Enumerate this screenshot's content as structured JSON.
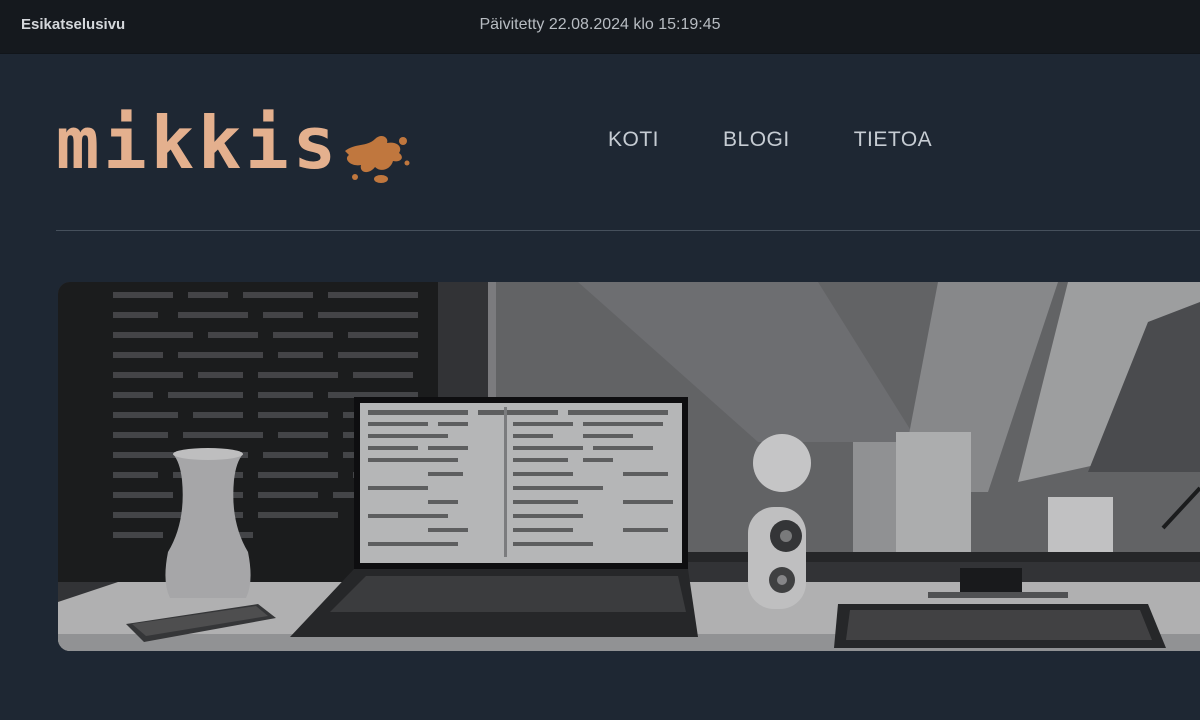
{
  "topbar": {
    "preview_label": "Esikatselusivu",
    "updated_text": "Päivitetty 22.08.2024 klo 15:19:45"
  },
  "brand": {
    "logo_text": "mikkis",
    "logo_color": "#e4b08e",
    "splat_color": "#c0773e"
  },
  "nav": {
    "items": [
      {
        "label": "KOTI"
      },
      {
        "label": "BLOGI"
      },
      {
        "label": "TIETOA"
      }
    ]
  },
  "hero": {
    "description": "grayscale illustration of a desk workspace with laptop, vase, speaker and monitor"
  },
  "colors": {
    "page_bg": "#1e2733",
    "topbar_bg": "#15191e",
    "nav_text": "#c6ccd3"
  }
}
